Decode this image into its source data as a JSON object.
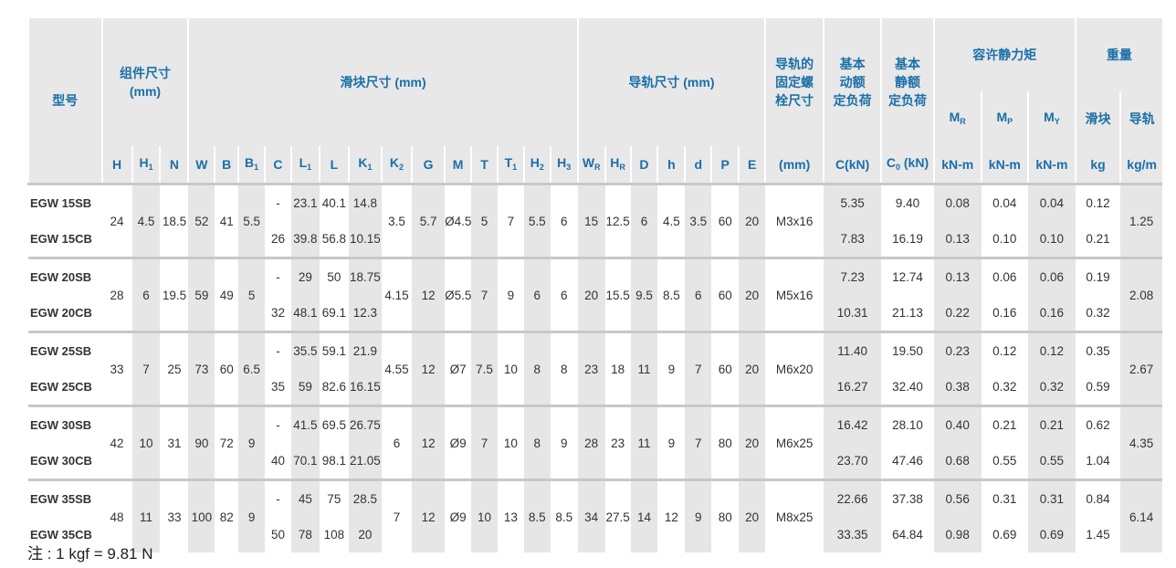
{
  "header": {
    "model": "型号",
    "assembly": "组件尺寸\n(mm)",
    "block": "滑块尺寸 (mm)",
    "rail": "导轨尺寸 (mm)",
    "rail_bolt": "导轨的\n固定螺\n栓尺寸",
    "dyn_load": "基本\n动额\n定负荷",
    "static_load": "基本\n静额\n定负荷",
    "moment": "容许静力矩",
    "weight": "重量",
    "weight_block": "滑块",
    "weight_rail": "导轨",
    "cols_assembly": [
      "H",
      "H1",
      "N"
    ],
    "cols_block": [
      "W",
      "B",
      "B1",
      "C",
      "L1",
      "L",
      "K1",
      "K2",
      "G",
      "M",
      "T",
      "T1",
      "H2",
      "H3"
    ],
    "cols_rail": [
      "WR",
      "HR",
      "D",
      "h",
      "d",
      "P",
      "E"
    ],
    "bolt_unit": "(mm)",
    "c_label": "C(kN)",
    "c0_label": "C0 (kN)",
    "mr": "MR",
    "mp": "MP",
    "my": "MY",
    "knm": "kN-m",
    "kg": "kg",
    "kgm": "kg/m"
  },
  "groups": [
    {
      "h": "24",
      "h1": "4.5",
      "n": "18.5",
      "w": "52",
      "b": "41",
      "b1": "5.5",
      "k2": "3.5",
      "g": "5.7",
      "m": "Ø4.5",
      "t": "5",
      "t1": "7",
      "h2": "5.5",
      "h3": "6",
      "wr": "15",
      "hr": "12.5",
      "d": "6",
      "hh": "4.5",
      "dd": "3.5",
      "p": "60",
      "e": "20",
      "bolt": "M3x16",
      "rail_wt": "1.25",
      "rows": [
        {
          "model": "EGW 15SB",
          "c": "-",
          "l1": "23.1",
          "l": "40.1",
          "k1": "14.8",
          "cdyn": "5.35",
          "cst": "9.40",
          "mr": "0.08",
          "mp": "0.04",
          "my": "0.04",
          "wt": "0.12"
        },
        {
          "model": "EGW 15CB",
          "c": "26",
          "l1": "39.8",
          "l": "56.8",
          "k1": "10.15",
          "cdyn": "7.83",
          "cst": "16.19",
          "mr": "0.13",
          "mp": "0.10",
          "my": "0.10",
          "wt": "0.21"
        }
      ]
    },
    {
      "h": "28",
      "h1": "6",
      "n": "19.5",
      "w": "59",
      "b": "49",
      "b1": "5",
      "k2": "4.15",
      "g": "12",
      "m": "Ø5.5",
      "t": "7",
      "t1": "9",
      "h2": "6",
      "h3": "6",
      "wr": "20",
      "hr": "15.5",
      "d": "9.5",
      "hh": "8.5",
      "dd": "6",
      "p": "60",
      "e": "20",
      "bolt": "M5x16",
      "rail_wt": "2.08",
      "rows": [
        {
          "model": "EGW 20SB",
          "c": "-",
          "l1": "29",
          "l": "50",
          "k1": "18.75",
          "cdyn": "7.23",
          "cst": "12.74",
          "mr": "0.13",
          "mp": "0.06",
          "my": "0.06",
          "wt": "0.19"
        },
        {
          "model": "EGW 20CB",
          "c": "32",
          "l1": "48.1",
          "l": "69.1",
          "k1": "12.3",
          "cdyn": "10.31",
          "cst": "21.13",
          "mr": "0.22",
          "mp": "0.16",
          "my": "0.16",
          "wt": "0.32"
        }
      ]
    },
    {
      "h": "33",
      "h1": "7",
      "n": "25",
      "w": "73",
      "b": "60",
      "b1": "6.5",
      "k2": "4.55",
      "g": "12",
      "m": "Ø7",
      "t": "7.5",
      "t1": "10",
      "h2": "8",
      "h3": "8",
      "wr": "23",
      "hr": "18",
      "d": "11",
      "hh": "9",
      "dd": "7",
      "p": "60",
      "e": "20",
      "bolt": "M6x20",
      "rail_wt": "2.67",
      "rows": [
        {
          "model": "EGW 25SB",
          "c": "-",
          "l1": "35.5",
          "l": "59.1",
          "k1": "21.9",
          "cdyn": "11.40",
          "cst": "19.50",
          "mr": "0.23",
          "mp": "0.12",
          "my": "0.12",
          "wt": "0.35"
        },
        {
          "model": "EGW 25CB",
          "c": "35",
          "l1": "59",
          "l": "82.6",
          "k1": "16.15",
          "cdyn": "16.27",
          "cst": "32.40",
          "mr": "0.38",
          "mp": "0.32",
          "my": "0.32",
          "wt": "0.59"
        }
      ]
    },
    {
      "h": "42",
      "h1": "10",
      "n": "31",
      "w": "90",
      "b": "72",
      "b1": "9",
      "k2": "6",
      "g": "12",
      "m": "Ø9",
      "t": "7",
      "t1": "10",
      "h2": "8",
      "h3": "9",
      "wr": "28",
      "hr": "23",
      "d": "11",
      "hh": "9",
      "dd": "7",
      "p": "80",
      "e": "20",
      "bolt": "M6x25",
      "rail_wt": "4.35",
      "rows": [
        {
          "model": "EGW 30SB",
          "c": "-",
          "l1": "41.5",
          "l": "69.5",
          "k1": "26.75",
          "cdyn": "16.42",
          "cst": "28.10",
          "mr": "0.40",
          "mp": "0.21",
          "my": "0.21",
          "wt": "0.62"
        },
        {
          "model": "EGW 30CB",
          "c": "40",
          "l1": "70.1",
          "l": "98.1",
          "k1": "21.05",
          "cdyn": "23.70",
          "cst": "47.46",
          "mr": "0.68",
          "mp": "0.55",
          "my": "0.55",
          "wt": "1.04"
        }
      ]
    },
    {
      "h": "48",
      "h1": "11",
      "n": "33",
      "w": "100",
      "b": "82",
      "b1": "9",
      "k2": "7",
      "g": "12",
      "m": "Ø9",
      "t": "10",
      "t1": "13",
      "h2": "8.5",
      "h3": "8.5",
      "wr": "34",
      "hr": "27.5",
      "d": "14",
      "hh": "12",
      "dd": "9",
      "p": "80",
      "e": "20",
      "bolt": "M8x25",
      "rail_wt": "6.14",
      "rows": [
        {
          "model": "EGW 35SB",
          "c": "-",
          "l1": "45",
          "l": "75",
          "k1": "28.5",
          "cdyn": "22.66",
          "cst": "37.38",
          "mr": "0.56",
          "mp": "0.31",
          "my": "0.31",
          "wt": "0.84"
        },
        {
          "model": "EGW 35CB",
          "c": "50",
          "l1": "78",
          "l": "108",
          "k1": "20",
          "cdyn": "33.35",
          "cst": "64.84",
          "mr": "0.98",
          "mp": "0.69",
          "my": "0.69",
          "wt": "1.45"
        }
      ]
    }
  ],
  "note": "注 : 1 kgf = 9.81 N"
}
